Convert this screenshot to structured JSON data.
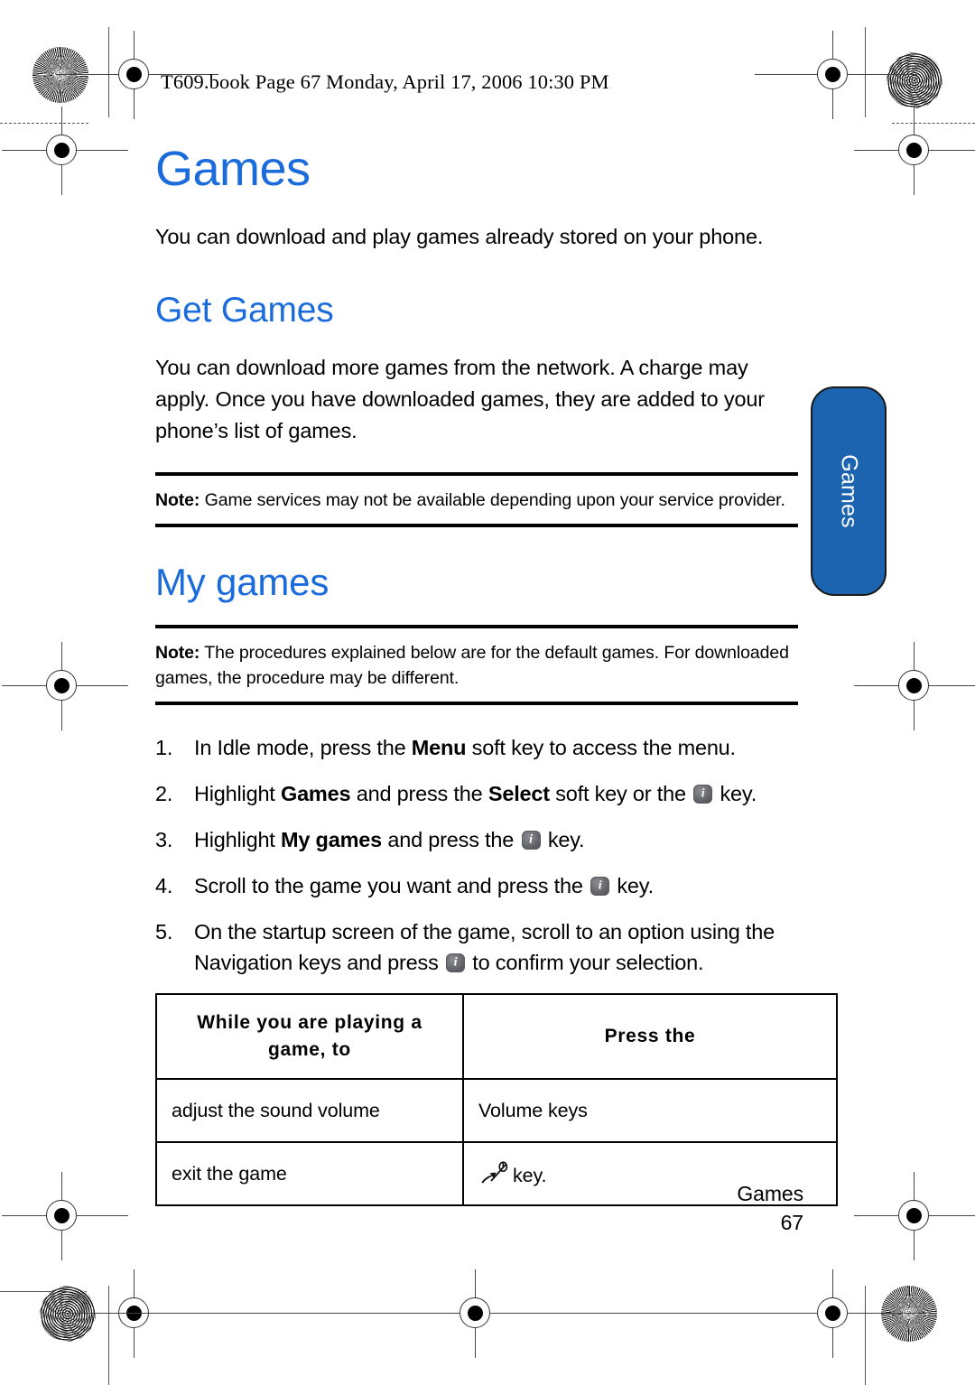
{
  "print_header": "T609.book  Page 67  Monday, April 17, 2006  10:30 PM",
  "content": {
    "title": "Games",
    "intro": "You can download and play games already stored on your phone.",
    "get_games": {
      "heading": "Get Games",
      "body": "You can download more games from the network. A charge may apply. Once you have downloaded games, they are added to your phone’s list of games.",
      "note_label": "Note:",
      "note_text": "Game services may not be available depending upon your service provider."
    },
    "my_games": {
      "heading": "My games",
      "note_label": "Note:",
      "note_text": "The procedures explained below are for the default games. For downloaded games, the procedure may be different.",
      "steps": [
        {
          "num": "1.",
          "parts": [
            {
              "t": "In Idle mode, press the ",
              "b": false
            },
            {
              "t": "Menu",
              "b": true
            },
            {
              "t": " soft key to access the menu.",
              "b": false
            }
          ]
        },
        {
          "num": "2.",
          "parts": [
            {
              "t": "Highlight ",
              "b": false
            },
            {
              "t": "Games",
              "b": true
            },
            {
              "t": " and press the ",
              "b": false
            },
            {
              "t": "Select",
              "b": true
            },
            {
              "t": " soft key or the ",
              "b": false
            },
            {
              "t": "[select-key-icon]",
              "b": false
            },
            {
              "t": " key.",
              "b": false
            }
          ]
        },
        {
          "num": "3.",
          "parts": [
            {
              "t": "Highlight ",
              "b": false
            },
            {
              "t": "My games",
              "b": true
            },
            {
              "t": " and press the ",
              "b": false
            },
            {
              "t": "[select-key-icon]",
              "b": false
            },
            {
              "t": " key.",
              "b": false
            }
          ]
        },
        {
          "num": "4.",
          "parts": [
            {
              "t": "Scroll to the game you want and press the ",
              "b": false
            },
            {
              "t": "[select-key-icon]",
              "b": false
            },
            {
              "t": " key.",
              "b": false
            }
          ]
        },
        {
          "num": "5.",
          "parts": [
            {
              "t": "On the startup screen of the game, scroll to an option using the Navigation keys and press ",
              "b": false
            },
            {
              "t": "[select-key-icon]",
              "b": false
            },
            {
              "t": " to confirm your selection.",
              "b": false
            }
          ]
        }
      ]
    },
    "table": {
      "headers": [
        "While you are playing a game, to",
        "Press the"
      ],
      "rows": [
        {
          "action": "adjust the sound volume",
          "press": "Volume keys",
          "icon": null
        },
        {
          "action": "exit the game",
          "press": "key.",
          "icon": "end-call-icon"
        }
      ]
    }
  },
  "side_tab": {
    "label": "Games"
  },
  "footer": {
    "section": "Games",
    "page_number": "67"
  },
  "colors": {
    "heading_blue": "#1a6bdb",
    "tab_blue": "#1c63b0",
    "text_black": "#000000"
  }
}
